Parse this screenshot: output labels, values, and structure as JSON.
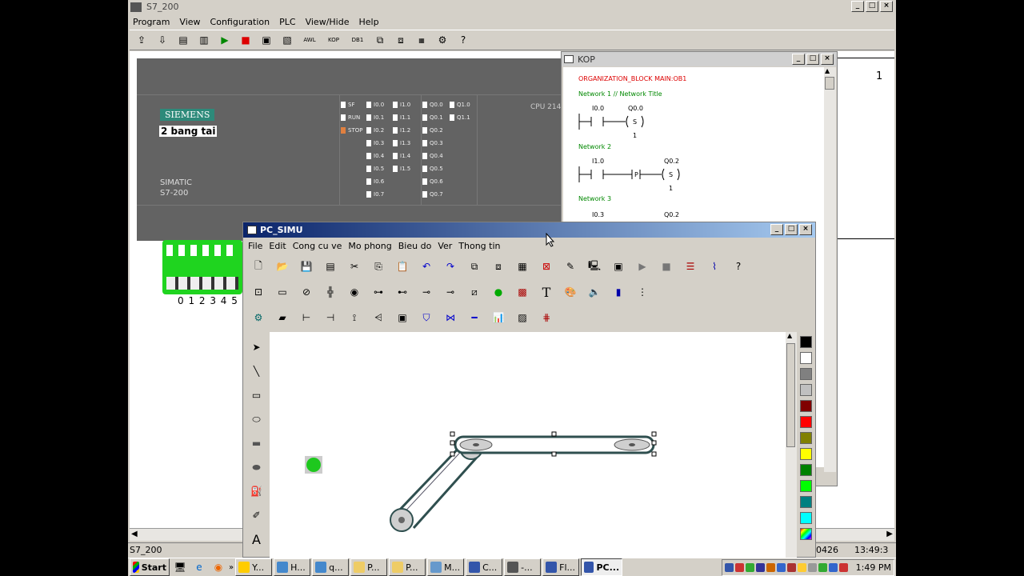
{
  "s7": {
    "title": "S7_200",
    "menu": [
      "Program",
      "View",
      "Configuration",
      "PLC",
      "View/Hide",
      "Help"
    ],
    "toolbar_text": [
      "AWL",
      "KOP",
      "DB1"
    ],
    "brand": "SIEMENS",
    "project_label": "2 bang tai",
    "simatic": "SIMATIC",
    "model": "S7-200",
    "cpu": "CPU 214",
    "status_leds": [
      "SF",
      "RUN",
      "STOP"
    ],
    "inputs_col1": [
      "I0.0",
      "I0.1",
      "I0.2",
      "I0.3",
      "I0.4",
      "I0.5",
      "I0.6",
      "I0.7"
    ],
    "inputs_col2": [
      "I1.0",
      "I1.1",
      "I1.2",
      "I1.3",
      "I1.4",
      "I1.5"
    ],
    "outputs_col1": [
      "Q0.0",
      "Q0.1",
      "Q0.2",
      "Q0.3",
      "Q0.4",
      "Q0.5",
      "Q0.6",
      "Q0.7"
    ],
    "outputs_col2": [
      "Q1.0",
      "Q1.1"
    ],
    "switch_numbers": "0 1 2 3 4 5",
    "right_value": "1",
    "status_left": "S7_200",
    "status_mid": "0426",
    "status_time": "13:49:3"
  },
  "kop": {
    "title": "KOP",
    "block": "ORGANIZATION_BLOCK MAIN:OB1",
    "net1_title": "Network 1 // Network Title",
    "net1_contact": "I0.0",
    "net1_coil": "Q0.0",
    "net1_coil_sym": "S",
    "net1_n": "1",
    "net2_title": "Network 2",
    "net2_contact": "I1.0",
    "net2_edge": "P",
    "net2_coil": "Q0.2",
    "net2_coil_sym": "S",
    "net2_n": "1",
    "net3_title": "Network 3",
    "net3_contact": "I0.3",
    "net3_coil": "Q0.2"
  },
  "pcsimu": {
    "title": "PC_SIMU",
    "menu": [
      "File",
      "Edit",
      "Cong cu ve",
      "Mo phong",
      "Bieu do",
      "Ver",
      "Thong tin"
    ],
    "palette": [
      "#000000",
      "#ffffff",
      "#808080",
      "#c0c0c0",
      "#800000",
      "#ff0000",
      "#808000",
      "#ffff00",
      "#008000",
      "#00ff00",
      "#008080",
      "#00ffff"
    ]
  },
  "taskbar": {
    "start": "Start",
    "items": [
      "Y...",
      "H...",
      "q...",
      "P...",
      "P...",
      "M...",
      "C...",
      "-...",
      "Fl...",
      "PC..."
    ],
    "clock": "1:49 PM"
  }
}
